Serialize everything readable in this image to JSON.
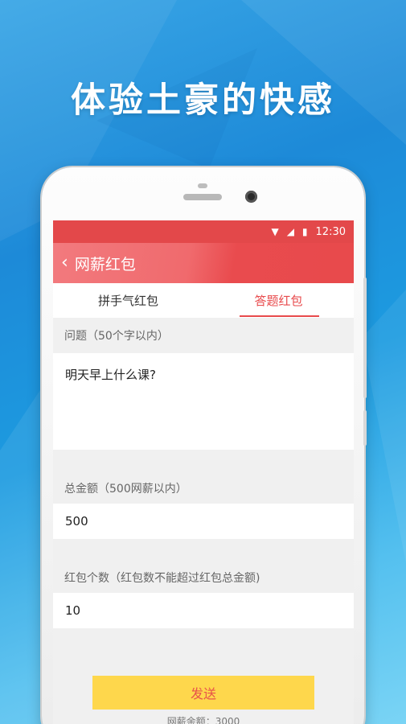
{
  "headline": "体验土豪的快感",
  "statusbar": {
    "time": "12:30",
    "icons": [
      "wifi-icon",
      "signal-icon",
      "battery-icon"
    ]
  },
  "appbar": {
    "back_icon": "chevron-left-icon",
    "title": "网薪红包"
  },
  "tabs": [
    {
      "label": "拼手气红包",
      "active": false
    },
    {
      "label": "答题红包",
      "active": true
    }
  ],
  "form": {
    "question_label": "问题（50个字以内）",
    "question_value": "明天早上什么课?",
    "amount_label": "总金额（500网薪以内）",
    "amount_value": "500",
    "count_label": "红包个数（红包数不能超过红包总金额)",
    "count_value": "10"
  },
  "send_label": "发送",
  "balance_text": "网薪余额：3000",
  "colors": {
    "accent": "#e84a4c",
    "button": "#fed74c",
    "button_text": "#e8534a"
  }
}
